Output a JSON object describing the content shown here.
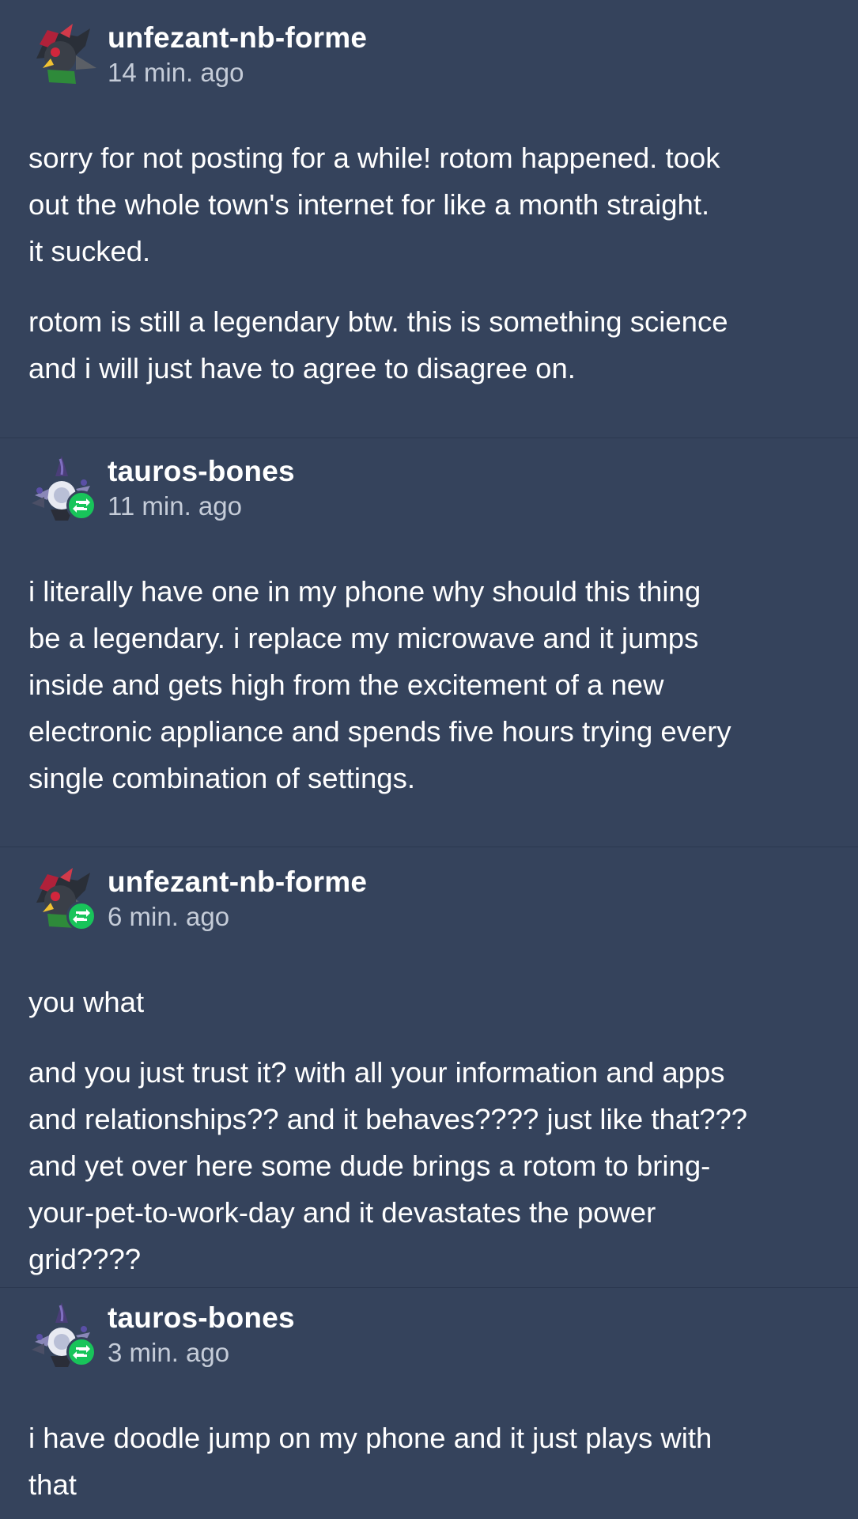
{
  "posts": [
    {
      "username": "unfezant-nb-forme",
      "time": "14 min. ago",
      "lines": [
        [
          "sorry for not posting for a while! rotom happened. took",
          "out the whole town's internet for like a month straight.",
          "it sucked."
        ],
        [
          "rotom is still a legendary btw. this is something science",
          "and i will just have to agree to disagree on."
        ]
      ]
    },
    {
      "username": "tauros-bones",
      "time": "11 min. ago",
      "lines": [
        [
          "i literally have one in my phone why should this thing",
          "be a legendary. i replace my microwave and it jumps",
          "inside and gets high from the excitement of a new",
          "electronic appliance and spends five hours trying every",
          "single combination of settings."
        ]
      ]
    },
    {
      "username": "unfezant-nb-forme",
      "time": "6 min. ago",
      "lines": [
        [
          "you what"
        ],
        [
          "and you just trust it? with all your information and apps",
          "and relationships?? and it behaves???? just like that???",
          "and yet over here some dude brings a rotom to bring-",
          "your-pet-to-work-day and it devastates the power",
          "grid????"
        ]
      ]
    },
    {
      "username": "tauros-bones",
      "time": "3 min. ago",
      "lines": [
        [
          "i have doodle jump on my phone and it just plays with",
          "that"
        ]
      ]
    }
  ],
  "colors": {
    "background": "#35435c",
    "text": "#ffffff",
    "timestamp": "#c5ccd8",
    "reblog_badge": "#18c45a"
  },
  "icons": {
    "avatar_1": "unfezant-avatar-icon",
    "avatar_2": "chandelure-avatar-icon",
    "reblog": "reblog-icon"
  }
}
